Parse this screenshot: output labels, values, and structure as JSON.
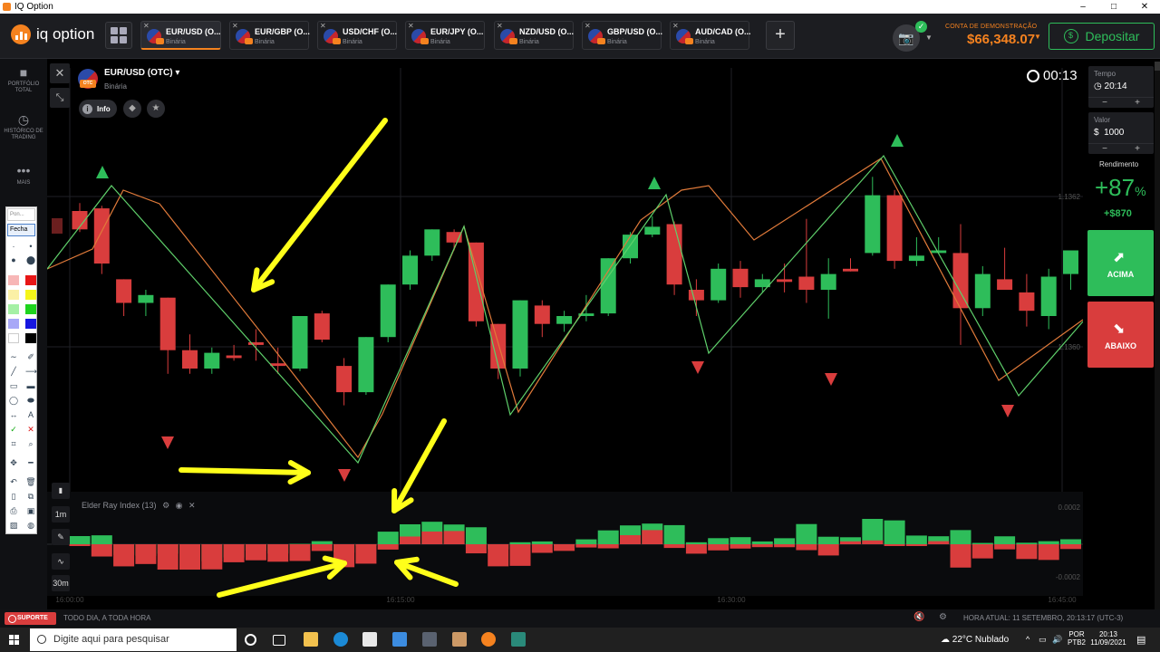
{
  "window": {
    "title": "IQ Option",
    "buttons": [
      "–",
      "□",
      "✕"
    ]
  },
  "logo": {
    "text": "iq option"
  },
  "tabs": [
    {
      "name": "EUR/USD (O...",
      "sub": "Binária",
      "active": true
    },
    {
      "name": "EUR/GBP (O...",
      "sub": "Binária"
    },
    {
      "name": "USD/CHF (O...",
      "sub": "Binária"
    },
    {
      "name": "EUR/JPY (O...",
      "sub": "Binária"
    },
    {
      "name": "NZD/USD (O...",
      "sub": "Binária"
    },
    {
      "name": "GBP/USD (O...",
      "sub": "Binária"
    },
    {
      "name": "AUD/CAD (O...",
      "sub": "Binária"
    }
  ],
  "account": {
    "label": "CONTA DE DEMONSTRAÇÃO",
    "balance": "$66,348.07",
    "deposit": "Depositar"
  },
  "sidebar": {
    "items": [
      {
        "label": "PORTFÓLIO TOTAL",
        "icon": "briefcase-icon"
      },
      {
        "label": "HISTÓRICO DE TRADING",
        "icon": "history-icon"
      },
      {
        "label": "MAIS",
        "icon": "more-icon"
      }
    ]
  },
  "palette": {
    "input": "Pon...",
    "button": "Fecha"
  },
  "chart_header": {
    "asset": "EUR/USD (OTC)",
    "type": "Binária",
    "flag_badge": "OTC",
    "info": "Info",
    "timer": "00:13"
  },
  "timeframes": {
    "candle": "1m",
    "expiry": "30m"
  },
  "indicator": {
    "label": "Elder Ray Index (13)"
  },
  "price_labels": [
    "1.1362",
    "1.1360"
  ],
  "indicator_labels": [
    "0.0002",
    "-0.0002"
  ],
  "time_labels": [
    "16:00:00",
    "16:15:00",
    "16:30:00",
    "16:45:00"
  ],
  "right_panel": {
    "tempo_label": "Tempo",
    "tempo_value": "20:14",
    "valor_label": "Valor",
    "valor_value": "1000",
    "valor_prefix": "$",
    "rend_label": "Rendimento",
    "rend_pct": "+87",
    "rend_pct_suffix": "%",
    "rend_amount": "+$870",
    "up_label": "ACIMA",
    "down_label": "ABAIXO"
  },
  "status": {
    "support": "SUPORTE",
    "hours": "TODO DIA, A TODA HORA",
    "current_time": "HORA ATUAL: 11 SETEMBRO, 20:13:17 (UTC-3)"
  },
  "taskbar": {
    "search_placeholder": "Digite aqui para pesquisar",
    "weather": "22°C  Nublado",
    "lang1": "POR",
    "lang2": "PTB2",
    "time": "20:13",
    "date": "11/09/2021"
  },
  "chart_data": {
    "type": "candlestick",
    "price_ticks": [
      1.1362,
      1.136
    ],
    "candles": [
      {
        "o": 1.1362,
        "h": 1.13623,
        "c": 1.13613,
        "l": 1.13612
      },
      {
        "o": 1.13621,
        "h": 1.13622,
        "c": 1.136,
        "l": 1.13596
      },
      {
        "o": 1.13594,
        "h": 1.13594,
        "c": 1.13585,
        "l": 1.1358
      },
      {
        "o": 1.13585,
        "h": 1.1359,
        "c": 1.13588,
        "l": 1.1358
      },
      {
        "o": 1.13587,
        "h": 1.13587,
        "c": 1.13567,
        "l": 1.13558
      },
      {
        "o": 1.13567,
        "h": 1.13573,
        "c": 1.1356,
        "l": 1.13558
      },
      {
        "o": 1.1356,
        "h": 1.13568,
        "c": 1.13566,
        "l": 1.13558
      },
      {
        "o": 1.13565,
        "h": 1.13569,
        "c": 1.13564,
        "l": 1.13563
      },
      {
        "o": 1.1357,
        "h": 1.13575,
        "c": 1.13569,
        "l": 1.13563
      },
      {
        "o": 1.13562,
        "h": 1.13568,
        "c": 1.13561,
        "l": 1.13558
      },
      {
        "o": 1.1356,
        "h": 1.1358,
        "c": 1.1358,
        "l": 1.13559
      },
      {
        "o": 1.13581,
        "h": 1.13582,
        "c": 1.13571,
        "l": 1.1357
      },
      {
        "o": 1.13561,
        "h": 1.13564,
        "c": 1.13551,
        "l": 1.13546
      },
      {
        "o": 1.13551,
        "h": 1.13572,
        "c": 1.13572,
        "l": 1.1355
      },
      {
        "o": 1.13572,
        "h": 1.13592,
        "c": 1.13592,
        "l": 1.1357
      },
      {
        "o": 1.13592,
        "h": 1.13605,
        "c": 1.13603,
        "l": 1.1359
      },
      {
        "o": 1.13603,
        "h": 1.13613,
        "c": 1.13613,
        "l": 1.13601
      },
      {
        "o": 1.13612,
        "h": 1.13613,
        "c": 1.13608,
        "l": 1.13605
      },
      {
        "o": 1.13608,
        "h": 1.13608,
        "c": 1.13578,
        "l": 1.13576
      },
      {
        "o": 1.13577,
        "h": 1.13577,
        "c": 1.1356,
        "l": 1.13556
      },
      {
        "o": 1.1356,
        "h": 1.13586,
        "c": 1.13586,
        "l": 1.13557
      },
      {
        "o": 1.13584,
        "h": 1.13586,
        "c": 1.13577,
        "l": 1.13572
      },
      {
        "o": 1.13577,
        "h": 1.13582,
        "c": 1.1358,
        "l": 1.13574
      },
      {
        "o": 1.1358,
        "h": 1.13588,
        "c": 1.13581,
        "l": 1.13578
      },
      {
        "o": 1.13581,
        "h": 1.13602,
        "c": 1.13602,
        "l": 1.1358
      },
      {
        "o": 1.13602,
        "h": 1.13612,
        "c": 1.13611,
        "l": 1.136
      },
      {
        "o": 1.13611,
        "h": 1.13618,
        "c": 1.13614,
        "l": 1.1361
      },
      {
        "o": 1.13615,
        "h": 1.13616,
        "c": 1.13592,
        "l": 1.13588
      },
      {
        "o": 1.1359,
        "h": 1.13594,
        "c": 1.13586,
        "l": 1.1358
      },
      {
        "o": 1.13586,
        "h": 1.136,
        "c": 1.13598,
        "l": 1.13585
      },
      {
        "o": 1.13598,
        "h": 1.13601,
        "c": 1.13591,
        "l": 1.13587
      },
      {
        "o": 1.13591,
        "h": 1.13596,
        "c": 1.13594,
        "l": 1.13589
      },
      {
        "o": 1.13594,
        "h": 1.136,
        "c": 1.13593,
        "l": 1.13589
      },
      {
        "o": 1.13595,
        "h": 1.13617,
        "c": 1.1359,
        "l": 1.13585
      },
      {
        "o": 1.1359,
        "h": 1.13602,
        "c": 1.13596,
        "l": 1.13579
      },
      {
        "o": 1.13598,
        "h": 1.13602,
        "c": 1.13597,
        "l": 1.13597
      },
      {
        "o": 1.13604,
        "h": 1.13633,
        "c": 1.13626,
        "l": 1.13603
      },
      {
        "o": 1.13626,
        "h": 1.13628,
        "c": 1.13601,
        "l": 1.13598
      },
      {
        "o": 1.13601,
        "h": 1.1361,
        "c": 1.13603,
        "l": 1.13599
      },
      {
        "o": 1.13604,
        "h": 1.1361,
        "c": 1.13605,
        "l": 1.13604
      },
      {
        "o": 1.13604,
        "h": 1.13615,
        "c": 1.13583,
        "l": 1.13569
      },
      {
        "o": 1.13583,
        "h": 1.13599,
        "c": 1.13596,
        "l": 1.1358
      },
      {
        "o": 1.13594,
        "h": 1.13606,
        "c": 1.1359,
        "l": 1.1359
      },
      {
        "o": 1.13589,
        "h": 1.13596,
        "c": 1.13582,
        "l": 1.13576
      },
      {
        "o": 1.1358,
        "h": 1.13598,
        "c": 1.13595,
        "l": 1.13575
      },
      {
        "o": 1.13596,
        "h": 1.13602,
        "c": 1.13605,
        "l": 1.1359
      }
    ]
  }
}
